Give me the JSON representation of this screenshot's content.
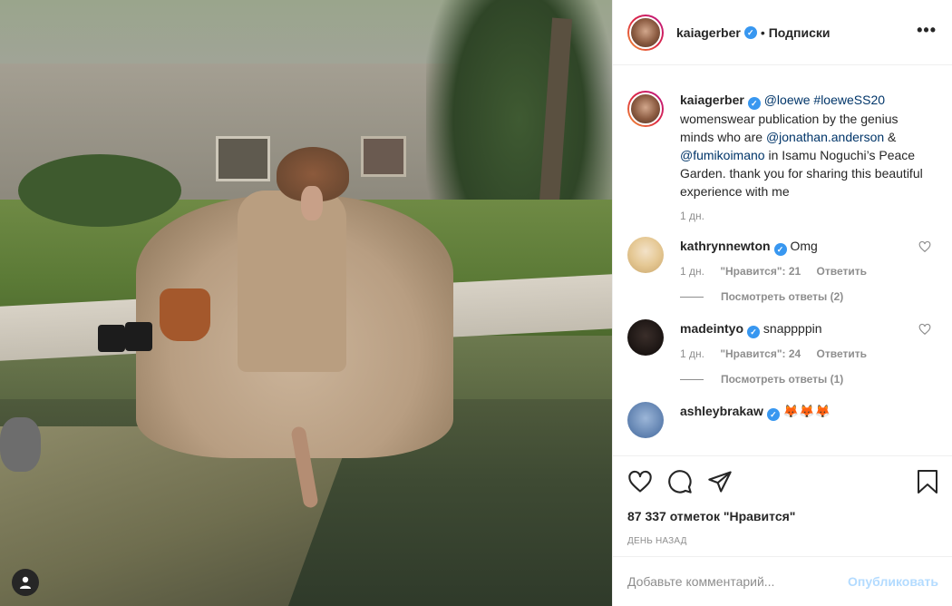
{
  "post": {
    "username": "kaiagerber",
    "header_separator": "•",
    "follow_status": "Подписки",
    "more_label": "•••"
  },
  "caption": {
    "username": "kaiagerber",
    "mention1": "@loewe",
    "hashtag": "#loeweSS20",
    "text1": "womenswear publication by the genius minds who are",
    "mention2": "@jonathan.anderson",
    "amp": "&",
    "mention3": "@fumikoimano",
    "text2": "in Isamu Noguchi’s Peace Garden. thank you for sharing this beautiful experience with me",
    "time": "1 дн."
  },
  "comments": [
    {
      "username": "kathrynnewton",
      "text": "Omg",
      "time": "1 дн.",
      "likes": "\"Нравится\": 21",
      "reply": "Ответить",
      "view_replies": "Посмотреть ответы (2)"
    },
    {
      "username": "madeintyo",
      "text": "snappppin",
      "time": "1 дн.",
      "likes": "\"Нравится\": 24",
      "reply": "Ответить",
      "view_replies": "Посмотреть ответы (1)"
    },
    {
      "username": "ashleybrakaw",
      "text": "🦊🦊🦊"
    }
  ],
  "actions": {
    "like_icon": "heart-icon",
    "comment_icon": "comment-icon",
    "share_icon": "share-icon",
    "save_icon": "bookmark-icon",
    "likes_count": "87 337 отметок \"Нравится\"",
    "ago": "ДЕНЬ НАЗАД"
  },
  "add_comment": {
    "placeholder": "Добавьте комментарий...",
    "publish": "Опубликовать"
  },
  "colors": {
    "link": "#003569",
    "verified": "#3897f0",
    "muted": "#8e8e8e",
    "publish_disabled": "#b3dbff"
  }
}
